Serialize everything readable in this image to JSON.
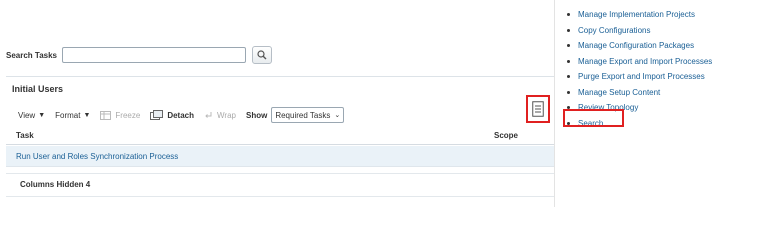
{
  "search": {
    "label": "Search Tasks",
    "value": "",
    "placeholder": ""
  },
  "panel": {
    "title": "Initial Users",
    "toolbar": {
      "view": "View",
      "format": "Format",
      "freeze": "Freeze",
      "detach": "Detach",
      "wrap": "Wrap",
      "show_label": "Show",
      "show_value": "Required Tasks"
    },
    "columns": {
      "task": "Task",
      "scope": "Scope"
    },
    "rows": [
      {
        "task": "Run User and Roles Synchronization Process"
      }
    ],
    "footer": {
      "label": "Columns Hidden",
      "count": "4"
    }
  },
  "right_panel": {
    "items": [
      "Manage Implementation Projects",
      "Copy Configurations",
      "Manage Configuration Packages",
      "Manage Export and Import Processes",
      "Purge Export and Import Processes",
      "Manage Setup Content",
      "Review Topology",
      "Search"
    ]
  },
  "colors": {
    "link": "#1a5f95",
    "highlight": "#e02020",
    "row_bg": "#eaf2f8"
  }
}
